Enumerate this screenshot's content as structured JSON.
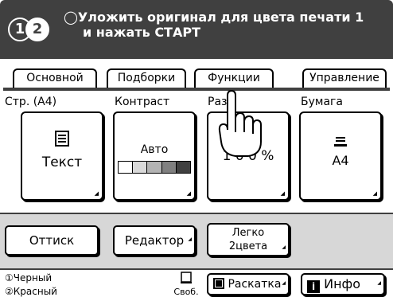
{
  "header": {
    "drum_1": "1",
    "drum_2": "2",
    "message_line1": "◯Уложить оригинал для цвета печати 1",
    "message_line2": "и нажать СТАРТ"
  },
  "tabs": [
    {
      "label": "Основной"
    },
    {
      "label": "Подборки"
    },
    {
      "label": "Функции"
    },
    {
      "label": "Управление"
    }
  ],
  "columns": {
    "page": {
      "label": "Стр. (А4)",
      "value": "Текст",
      "icon": "document-icon"
    },
    "contrast": {
      "label": "Контраст",
      "value": "Авто",
      "levels": 5,
      "selected": 5
    },
    "zoom": {
      "label": "Раз",
      "value": "1 0 0 %"
    },
    "paper": {
      "label": "Бумага",
      "value": "A4",
      "icon": "paper-tray-icon"
    }
  },
  "actions": {
    "proof": "Оттиск",
    "editor": "Редактор",
    "easy_2color_line1": "Легко",
    "easy_2color_line2": "2цвета"
  },
  "status": {
    "drum1": "Черный",
    "drum2": "Красный",
    "free": "Своб.",
    "collate": "Раскатка",
    "info": "Инфо"
  },
  "colors": {
    "header_bg": "#404040",
    "gray_area": "#d7d7d7",
    "contrast_levels": [
      "#ffffff",
      "#d9d9d9",
      "#b3b3b3",
      "#808080",
      "#404040"
    ]
  }
}
